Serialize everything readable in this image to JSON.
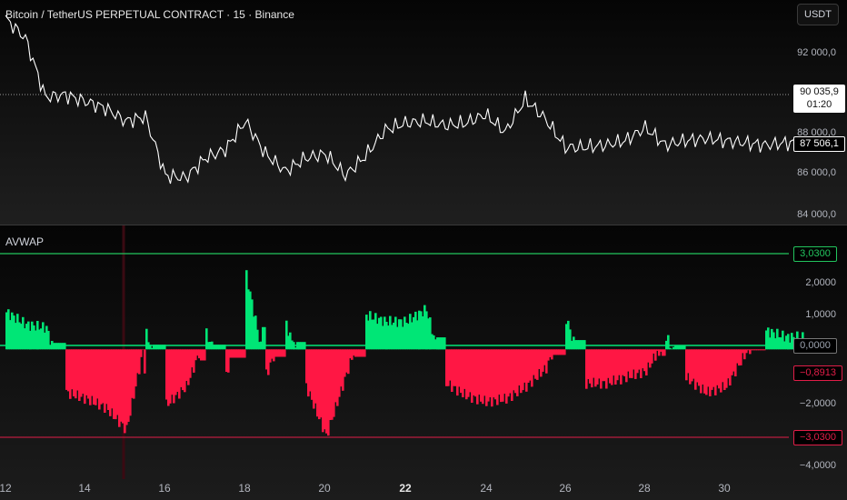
{
  "header": {
    "title": "Bitcoin / TetherUS PERPETUAL CONTRACT · 15 · Binance",
    "quote_currency": "USDT"
  },
  "price_axis": {
    "ticks": [
      "92 000,0",
      "88 000,0",
      "86 000,0",
      "84 000,0"
    ]
  },
  "price_tags": {
    "last_price": "90 035,9",
    "countdown": "01:20",
    "current": "87 506,1"
  },
  "indicator": {
    "name": "AVWAP",
    "ticks": [
      "2,0000",
      "1,0000",
      "−2,0000",
      "−4,0000"
    ],
    "upper_band": "3,0300",
    "zero": "0,0000",
    "value": "−0,8913",
    "lower_band": "−3,0300"
  },
  "time_axis": {
    "labels": [
      "12",
      "14",
      "16",
      "18",
      "20",
      "22",
      "24",
      "26",
      "28",
      "30"
    ],
    "bold_label": "22"
  },
  "colors": {
    "background": "#0d0d0d",
    "price_line": "#ffffff",
    "positive": "#00e676",
    "negative": "#ff1744",
    "upper_band": "#22c55e",
    "lower_band": "#e11d48"
  },
  "chart_data": [
    {
      "type": "line",
      "title": "Bitcoin / TetherUS PERPETUAL CONTRACT · 15 · Binance",
      "x": [
        "12",
        "12.5",
        "13",
        "13.5",
        "14",
        "14.5",
        "15",
        "15.5",
        "16",
        "16.5",
        "17",
        "17.5",
        "18",
        "18.5",
        "19",
        "19.5",
        "20",
        "20.5",
        "21",
        "21.5",
        "22",
        "22.5",
        "23",
        "23.5",
        "24",
        "24.5",
        "25",
        "25.5",
        "26",
        "26.5",
        "27",
        "27.5",
        "28",
        "28.5",
        "29",
        "29.5",
        "30",
        "30.5",
        "31",
        "31.5"
      ],
      "series": [
        {
          "values": [
            93200,
            92300,
            89600,
            89700,
            89400,
            89100,
            88500,
            88700,
            86000,
            85900,
            86800,
            87200,
            88500,
            87000,
            86200,
            86800,
            87000,
            86000,
            86900,
            88100,
            88400,
            88500,
            88300,
            88400,
            88800,
            88000,
            89500,
            88600,
            87300,
            87300,
            87400,
            87600,
            88200,
            87400,
            87600,
            87700,
            87600,
            87500,
            87400,
            87500
          ]
        }
      ],
      "ylim": [
        83800,
        93800
      ],
      "grid": false
    },
    {
      "type": "area",
      "title": "AVWAP",
      "x": [
        "12",
        "12.5",
        "13",
        "13.5",
        "14",
        "14.5",
        "15",
        "15.5",
        "16",
        "16.5",
        "17",
        "17.5",
        "18",
        "18.5",
        "19",
        "19.5",
        "20",
        "20.5",
        "21",
        "21.5",
        "22",
        "22.5",
        "23",
        "23.5",
        "24",
        "24.5",
        "25",
        "25.5",
        "26",
        "26.5",
        "27",
        "27.5",
        "28",
        "28.5",
        "29",
        "29.5",
        "30",
        "30.5",
        "31",
        "31.5"
      ],
      "series": [
        {
          "values": [
            1.2,
            0.8,
            0.7,
            -1.4,
            -1.6,
            -1.9,
            -2.6,
            0.5,
            -1.8,
            -1.2,
            0.5,
            -0.9,
            2.4,
            -0.8,
            0.8,
            -1.2,
            -2.8,
            -0.8,
            1.1,
            0.9,
            0.9,
            1.3,
            -1.1,
            -1.5,
            -1.7,
            -1.6,
            -1.2,
            -0.6,
            1.0,
            -1.1,
            -1.1,
            -0.9,
            -0.7,
            0.4,
            -0.9,
            -1.4,
            -1.2,
            -0.1,
            0.6,
            0.4
          ]
        }
      ],
      "ylim": [
        -4.2,
        3.6
      ],
      "grid": false
    }
  ]
}
